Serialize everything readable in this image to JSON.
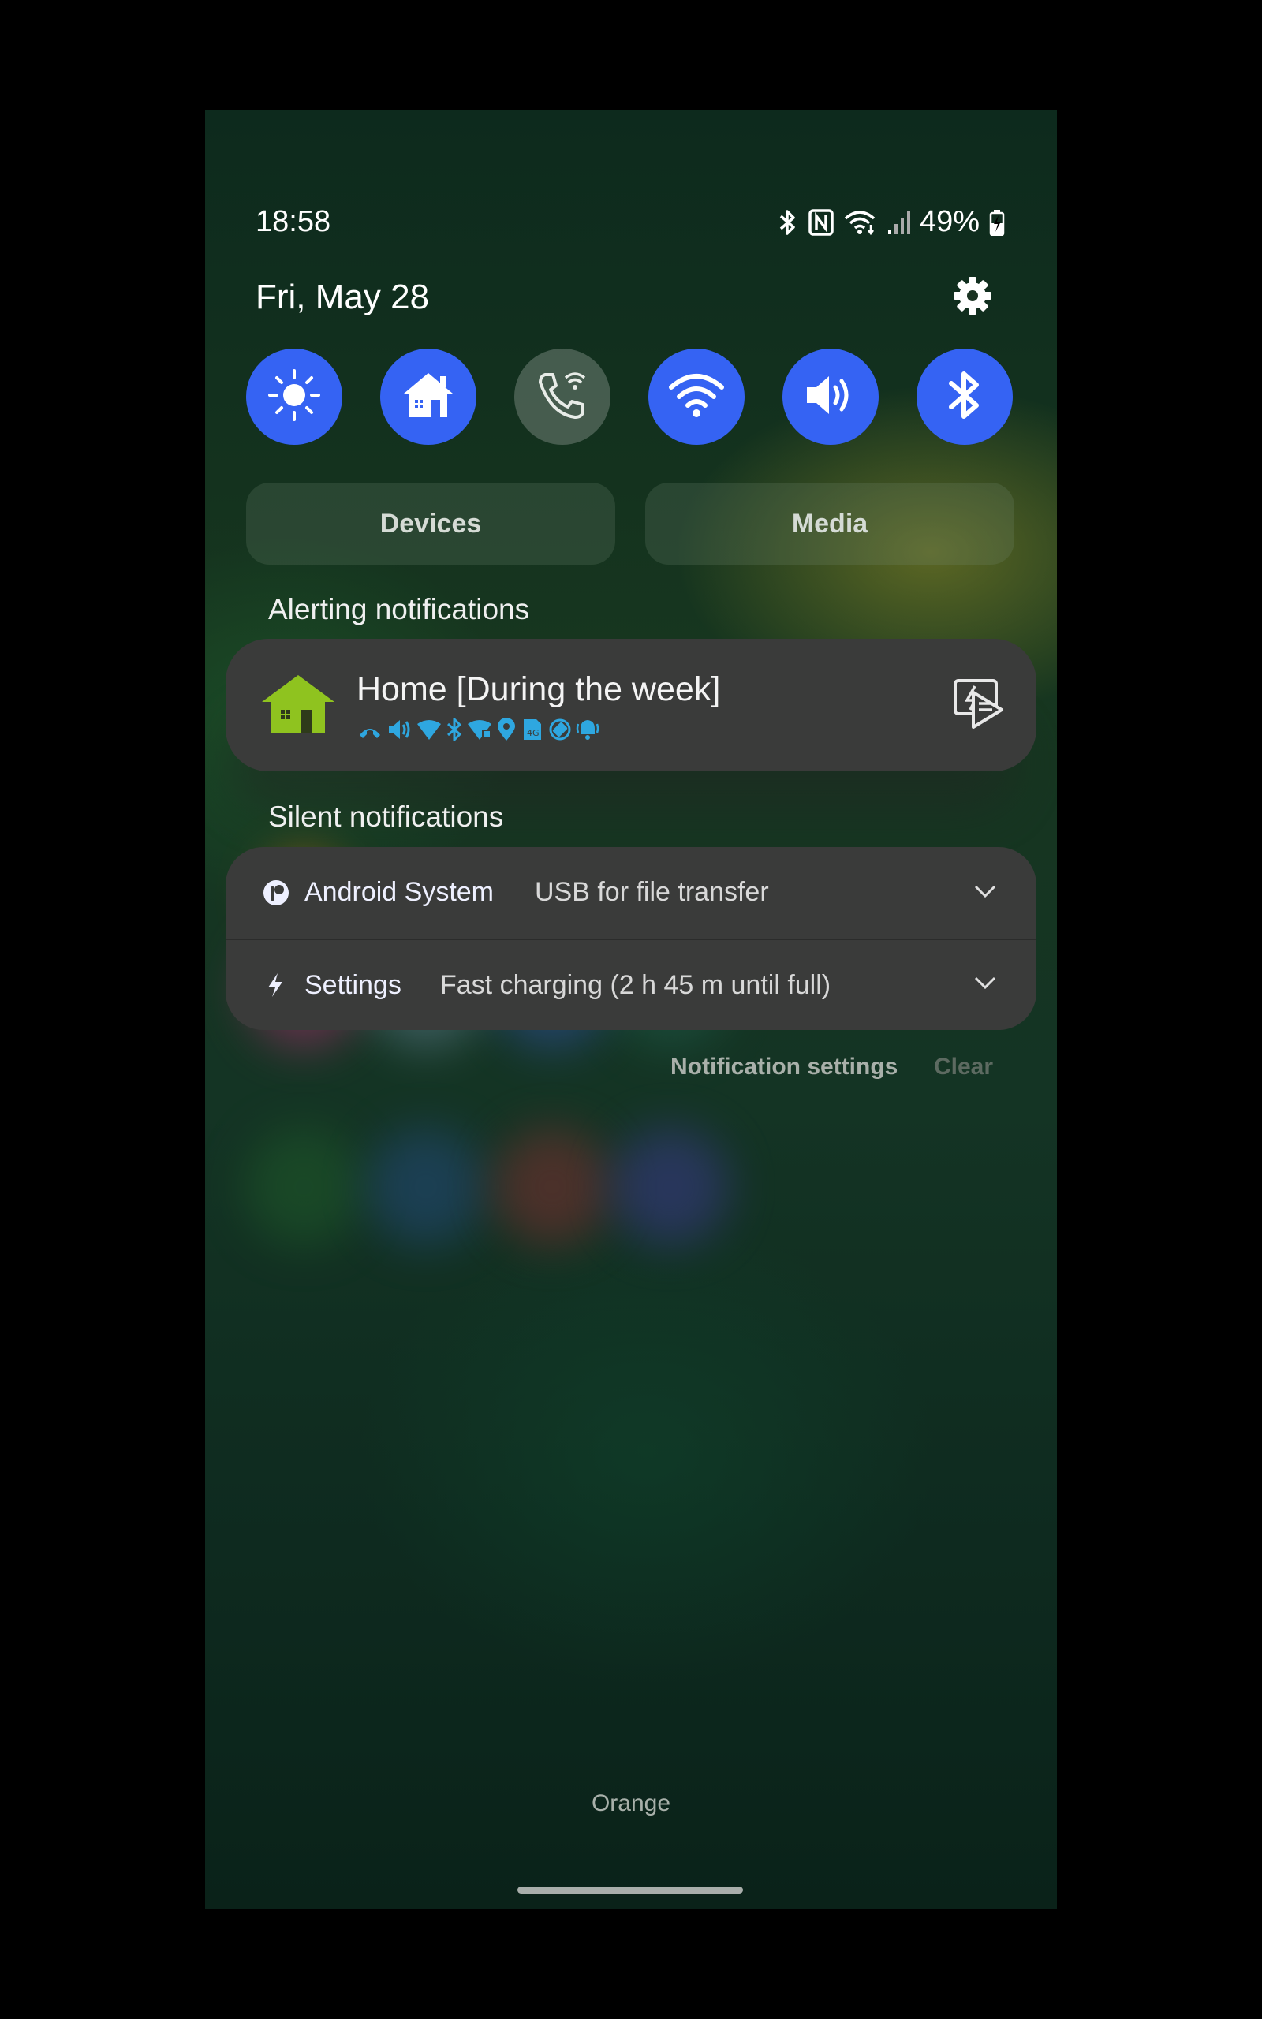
{
  "status_bar": {
    "time": "18:58",
    "battery": "49%",
    "icons": [
      "bluetooth-icon",
      "nfc-icon",
      "wifi-icon",
      "signal-icon",
      "battery-charging-icon"
    ]
  },
  "header": {
    "date": "Fri, May 28",
    "settings_icon": "gear-icon"
  },
  "quick_settings": {
    "tiles": [
      {
        "name": "brightness",
        "icon": "sun-icon",
        "active": true
      },
      {
        "name": "home",
        "icon": "home-icon",
        "active": true
      },
      {
        "name": "wifi-calling",
        "icon": "wifi-calling-icon",
        "active": false
      },
      {
        "name": "wifi",
        "icon": "wifi-icon",
        "active": true
      },
      {
        "name": "sound",
        "icon": "speaker-icon",
        "active": true
      },
      {
        "name": "bluetooth",
        "icon": "bluetooth-icon",
        "active": true
      }
    ],
    "devices_label": "Devices",
    "media_label": "Media"
  },
  "notifications": {
    "alerting_header": "Alerting notifications",
    "alerting": [
      {
        "title": "Home [During the week]",
        "icon": "house-icon",
        "action_icon": "quick-settings-icon"
      }
    ],
    "silent_header": "Silent notifications",
    "silent": [
      {
        "app": "Android System",
        "text": "USB for file transfer",
        "icon": "android-system-icon"
      },
      {
        "app": "Settings",
        "text": "Fast charging (2 h 45 m until full)",
        "icon": "lightning-icon"
      }
    ],
    "settings_label": "Notification settings",
    "clear_label": "Clear"
  },
  "home_screen": {
    "label": "Orange"
  },
  "colors": {
    "accent": "#3563f3",
    "house": "#8fc31f",
    "mini_icons": "#2ea7e0"
  }
}
